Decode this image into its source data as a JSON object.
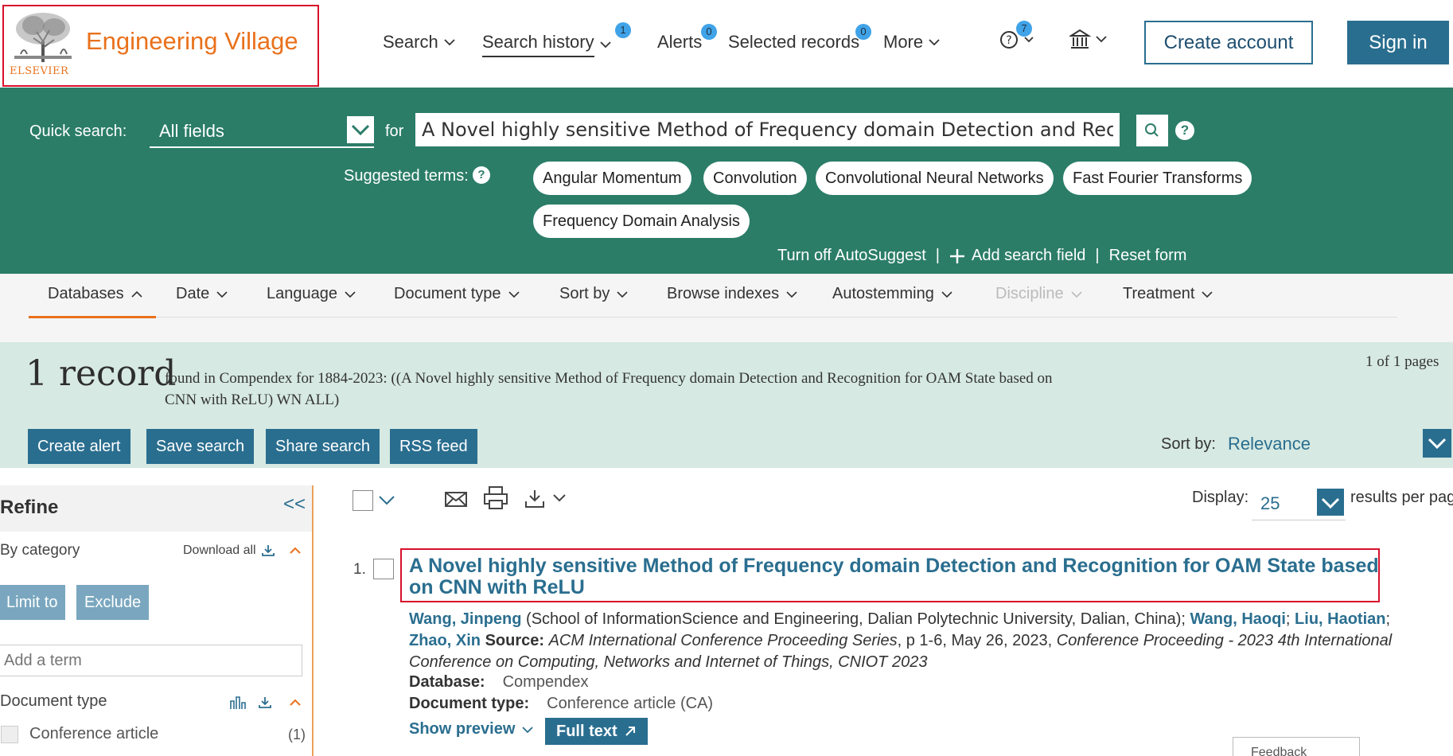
{
  "header": {
    "logo_text": "Engineering Village",
    "publisher": "ELSEVIER",
    "nav": {
      "search": "Search",
      "search_history": "Search history",
      "search_history_badge": "1",
      "alerts": "Alerts",
      "alerts_badge": "0",
      "selected_records": "Selected records",
      "selected_records_badge": "0",
      "more": "More",
      "help_badge": "7"
    },
    "create_account": "Create account",
    "sign_in": "Sign in"
  },
  "search": {
    "quick_search_label": "Quick search:",
    "field": "All fields",
    "for_label": "for",
    "query": "A Novel highly sensitive Method of Frequency domain Detection and Recognition for OAM State based on CNN with ReLU",
    "suggested_label": "Suggested terms:",
    "suggested_terms": [
      "Angular Momentum",
      "Convolution",
      "Convolutional Neural Networks",
      "Fast Fourier Transforms",
      "Frequency Domain Analysis"
    ],
    "turn_off_autosuggest": "Turn off AutoSuggest",
    "add_search_field": "Add search field",
    "reset_form": "Reset form"
  },
  "filters": [
    "Databases",
    "Date",
    "Language",
    "Document type",
    "Sort by",
    "Browse indexes",
    "Autostemming",
    "Discipline",
    "Treatment"
  ],
  "results": {
    "count": "1 record",
    "found_text": "found in Compendex for 1884-2023: ((A Novel highly sensitive Method of Frequency domain Detection and Recognition for OAM State based on CNN with ReLU) WN ALL)",
    "pages": "1 of 1 pages",
    "actions": [
      "Create alert",
      "Save search",
      "Share search",
      "RSS feed"
    ],
    "sort_by_label": "Sort by:",
    "sort_by_value": "Relevance",
    "display_label": "Display:",
    "display_value": "25",
    "per_page": "results per page"
  },
  "refine": {
    "title": "Refine",
    "collapse": "<<",
    "by_category": "By category",
    "download_all": "Download all",
    "limit_to": "Limit to",
    "exclude": "Exclude",
    "add_term_placeholder": "Add a term",
    "document_type_label": "Document type",
    "doc_types": [
      {
        "label": "Conference article",
        "count": "(1)"
      }
    ]
  },
  "record": {
    "number": "1.",
    "title": "A Novel highly sensitive Method of Frequency domain Detection and Recognition for OAM State based on CNN with ReLU",
    "author1": "Wang, Jinpeng",
    "affiliation": " (School of InformationScience and Engineering, Dalian Polytechnic University, Dalian, China); ",
    "author2": "Wang, Haoqi",
    "author3": "Liu, Haotian",
    "author4": "Zhao, Xin",
    "source_label": "Source:",
    "source": "ACM International Conference Proceeding Series",
    "source_rest": ", p 1-6, May 26, 2023, ",
    "source_conf": "Conference Proceeding - 2023 4th International Conference on Computing, Networks and Internet of Things, CNIOT 2023",
    "database_label": "Database:",
    "database": "Compendex",
    "doctype_label": "Document type:",
    "doctype": "Conference article (CA)",
    "show_preview": "Show preview",
    "full_text": "Full text"
  },
  "feedback": "Feedback",
  "colors": {
    "brand_orange": "#e9711c",
    "band_green": "#2b7d68",
    "accent_blue": "#2a6e8f",
    "highlight_red": "#d8102b"
  }
}
